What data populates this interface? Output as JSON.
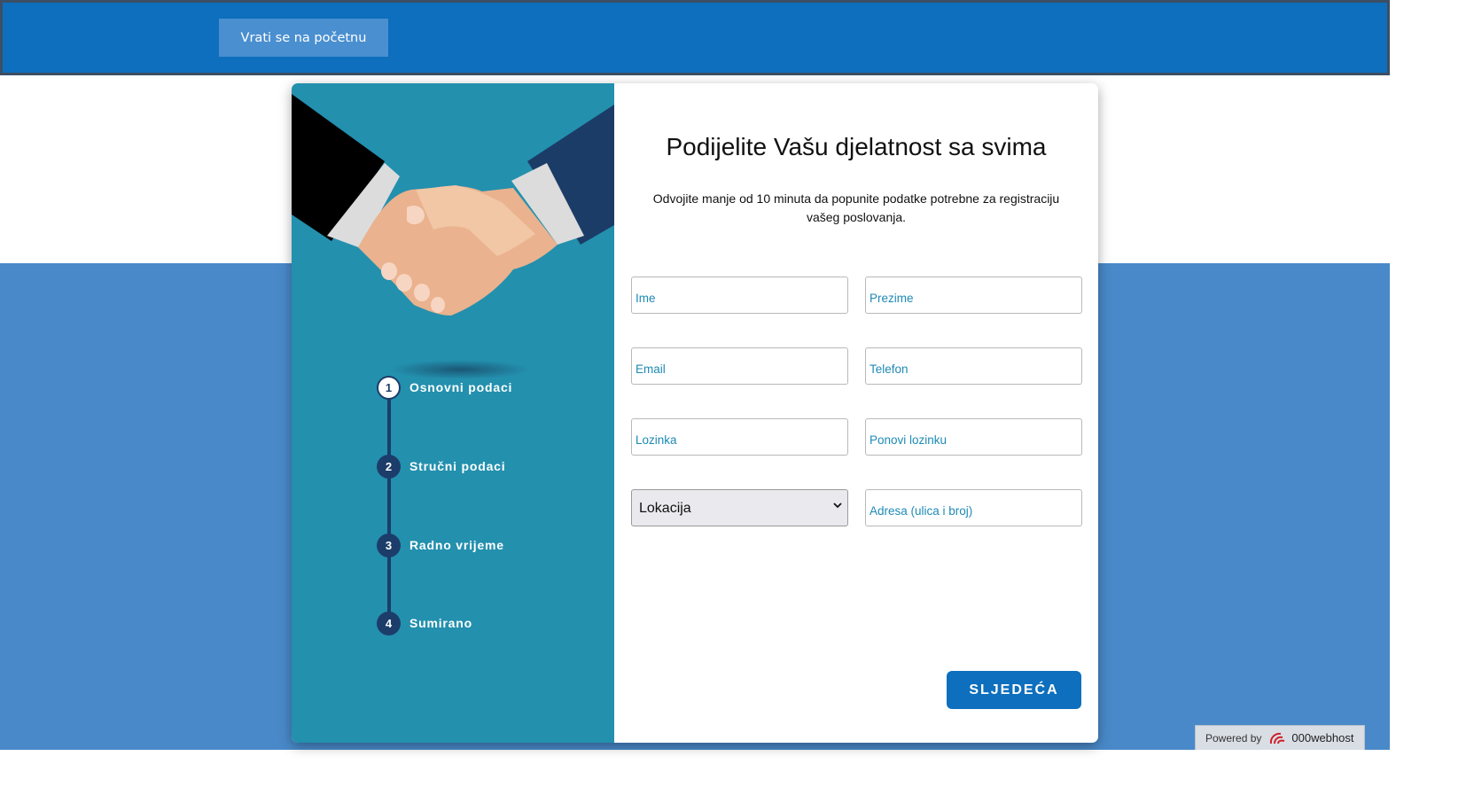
{
  "topbar": {
    "back_label": "Vrati se na početnu",
    "color": "#0d6fbd"
  },
  "steps": [
    {
      "num": "1",
      "label": "Osnovni podaci",
      "active": true
    },
    {
      "num": "2",
      "label": "Stručni podaci",
      "active": false
    },
    {
      "num": "3",
      "label": "Radno vrijeme",
      "active": false
    },
    {
      "num": "4",
      "label": "Sumirano",
      "active": false
    }
  ],
  "form": {
    "title": "Podijelite Vašu djelatnost sa svima",
    "subtitle": "Odvojite manje od 10 minuta da popunite podatke potrebne za registraciju vašeg poslovanja.",
    "fields": {
      "ime": "Ime",
      "prezime": "Prezime",
      "email": "Email",
      "telefon": "Telefon",
      "lozinka": "Lozinka",
      "ponovi_lozinku": "Ponovi lozinku",
      "lokacija": "Lokacija",
      "adresa": "Adresa (ulica i broj)"
    },
    "next_label": "SLJEDEĆA"
  },
  "footer": {
    "powered_by": "Powered by",
    "brand": "000webhost"
  },
  "icons": {
    "handshake": "handshake-illustration",
    "select": "chevron-down-icon",
    "brand_logo": "000webhost-logo-icon"
  }
}
